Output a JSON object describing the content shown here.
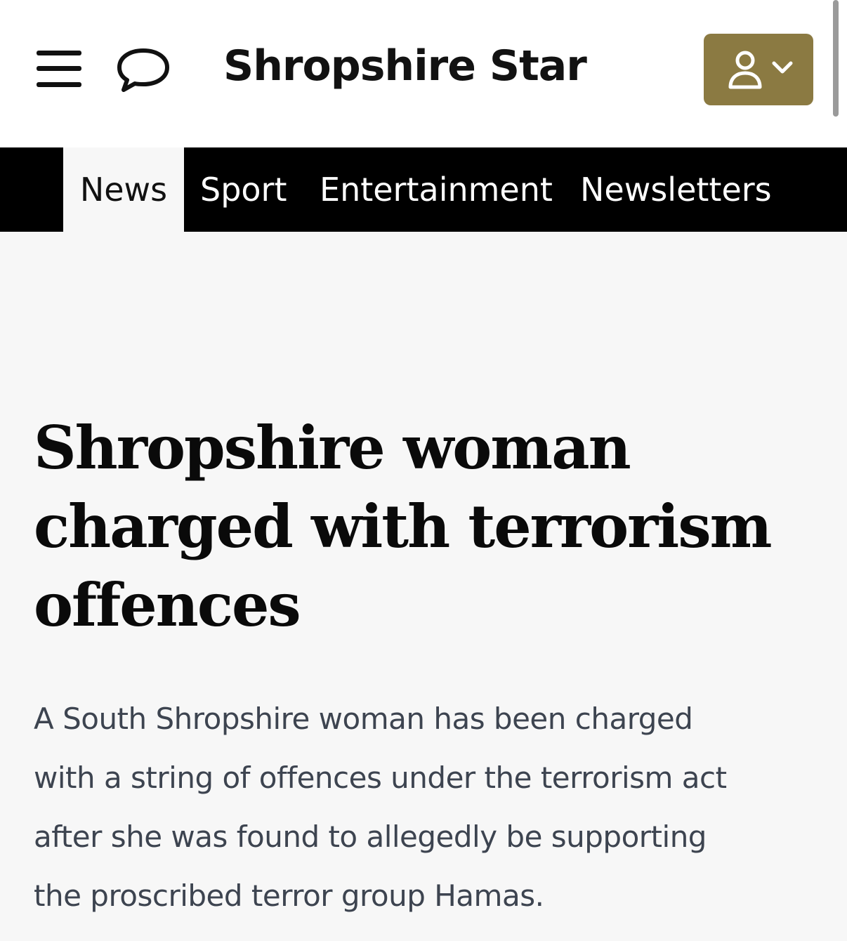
{
  "header": {
    "brand": "Shropshire Star",
    "menu_icon": "hamburger-menu-icon",
    "comments_icon": "speech-bubble-icon",
    "account_icon": "user-icon",
    "account_dropdown_icon": "chevron-down-icon",
    "account_button_color": "#8b7a42"
  },
  "nav": {
    "items": [
      {
        "label": "News",
        "active": true
      },
      {
        "label": "Sport",
        "active": false
      },
      {
        "label": "Entertainment",
        "active": false
      },
      {
        "label": "Newsletters",
        "active": false
      }
    ]
  },
  "article": {
    "headline_lines": [
      "Shropshire woman",
      "charged with terrorism",
      "offences"
    ],
    "standfirst_lines": [
      "A South Shropshire woman has been charged",
      "with a string of offences under the terrorism act",
      "after she was found to allegedly be supporting",
      "the proscribed terror group Hamas."
    ]
  }
}
